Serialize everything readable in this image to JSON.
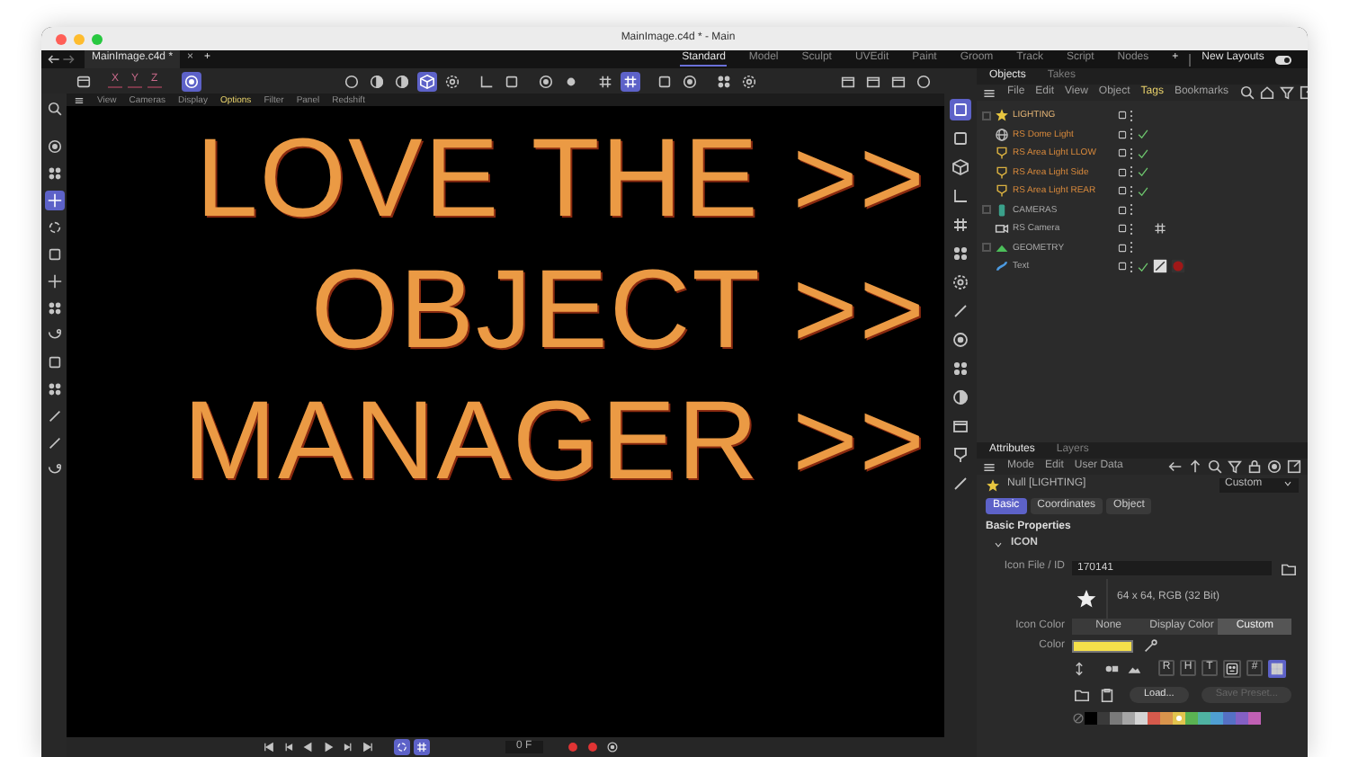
{
  "window": {
    "title": "MainImage.c4d * - Main"
  },
  "document_tab": {
    "label": "MainImage.c4d *",
    "close": "×",
    "add": "+"
  },
  "layouts": [
    {
      "label": "Standard",
      "selected": true
    },
    {
      "label": "Model",
      "selected": false
    },
    {
      "label": "Sculpt",
      "selected": false
    },
    {
      "label": "UVEdit",
      "selected": false
    },
    {
      "label": "Paint",
      "selected": false
    },
    {
      "label": "Groom",
      "selected": false
    },
    {
      "label": "Track",
      "selected": false
    },
    {
      "label": "Script",
      "selected": false
    },
    {
      "label": "Nodes",
      "selected": false
    }
  ],
  "layout_add": "+",
  "new_layouts": {
    "label": "New Layouts",
    "on": true
  },
  "axis_buttons": [
    {
      "label": "X",
      "selected": false
    },
    {
      "label": "Y",
      "selected": false
    },
    {
      "label": "Z",
      "selected": false
    }
  ],
  "toolbar_groups": [
    [
      {
        "kind": "archive",
        "selected": false
      }
    ],
    [
      {
        "kind": "target",
        "selected": true
      }
    ],
    [
      {
        "kind": "circle",
        "selected": false
      },
      {
        "kind": "halfcircle",
        "selected": false
      },
      {
        "kind": "halfcircle",
        "selected": false
      },
      {
        "kind": "cube",
        "selected": true
      },
      {
        "kind": "gear",
        "selected": false
      }
    ],
    [
      {
        "kind": "corner",
        "selected": false
      },
      {
        "kind": "square",
        "selected": false
      }
    ],
    [
      {
        "kind": "target",
        "selected": false
      },
      {
        "kind": "dot",
        "selected": false
      }
    ],
    [
      {
        "kind": "grid",
        "selected": false
      },
      {
        "kind": "grid",
        "selected": true
      }
    ],
    [
      {
        "kind": "square",
        "selected": false
      },
      {
        "kind": "target",
        "selected": false
      }
    ],
    [
      {
        "kind": "dots",
        "selected": false
      },
      {
        "kind": "gear",
        "selected": false
      }
    ],
    [
      {
        "kind": "clapper",
        "selected": false
      },
      {
        "kind": "clapper",
        "selected": false
      },
      {
        "kind": "clapper",
        "selected": false
      },
      {
        "kind": "circle",
        "selected": false
      }
    ]
  ],
  "left_tools": [
    {
      "kind": "search",
      "selected": false
    },
    {
      "kind": "target",
      "selected": false
    },
    {
      "kind": "dots",
      "selected": false
    },
    {
      "kind": "move",
      "selected": true
    },
    {
      "kind": "rotate",
      "selected": false
    },
    {
      "kind": "square",
      "selected": false
    },
    {
      "kind": "move",
      "selected": false
    },
    {
      "kind": "dots",
      "selected": false
    },
    {
      "kind": "arc",
      "selected": false
    },
    {
      "kind": "square",
      "selected": false
    },
    {
      "kind": "dots",
      "selected": false
    },
    {
      "kind": "line",
      "selected": false
    },
    {
      "kind": "line",
      "selected": false
    },
    {
      "kind": "arc",
      "selected": false
    }
  ],
  "viewport": {
    "menu": [
      {
        "label": "View",
        "selected": false
      },
      {
        "label": "Cameras",
        "selected": false
      },
      {
        "label": "Display",
        "selected": false
      },
      {
        "label": "Options",
        "selected": true
      },
      {
        "label": "Filter",
        "selected": false
      },
      {
        "label": "Panel",
        "selected": false
      },
      {
        "label": "Redshift",
        "selected": false
      }
    ],
    "text_lines": [
      "LOVE THE >>",
      "OBJECT >>",
      "MANAGER >>"
    ]
  },
  "timeline": {
    "controls": [
      {
        "kind": "skipback",
        "selected": false
      },
      {
        "kind": "stepback",
        "selected": false
      },
      {
        "kind": "playback",
        "selected": false
      },
      {
        "kind": "play",
        "selected": false
      },
      {
        "kind": "stepfwd",
        "selected": false
      },
      {
        "kind": "skipfwd",
        "selected": false
      },
      {
        "kind": "rotate",
        "selected": true
      },
      {
        "kind": "grid",
        "selected": true
      }
    ],
    "frame": "0 F",
    "record_controls": [
      {
        "kind": "record",
        "selected": false
      },
      {
        "kind": "record",
        "selected": false
      },
      {
        "kind": "target",
        "selected": false
      }
    ]
  },
  "right_strip": [
    {
      "kind": "square",
      "selected": true
    },
    {
      "kind": "square",
      "selected": false
    },
    {
      "kind": "cube",
      "selected": false
    },
    {
      "kind": "corner",
      "selected": false
    },
    {
      "kind": "grid",
      "selected": false
    },
    {
      "kind": "dots",
      "selected": false
    },
    {
      "kind": "gear",
      "selected": false
    },
    {
      "kind": "line",
      "selected": false
    },
    {
      "kind": "target",
      "selected": false
    },
    {
      "kind": "dots",
      "selected": false
    },
    {
      "kind": "halfcircle",
      "selected": false
    },
    {
      "kind": "clapper",
      "selected": false
    },
    {
      "kind": "lamp",
      "selected": false
    },
    {
      "kind": "line",
      "selected": false
    }
  ],
  "object_manager": {
    "tabs": [
      {
        "label": "Objects",
        "selected": true
      },
      {
        "label": "Takes",
        "selected": false
      }
    ],
    "menu": [
      {
        "label": "File",
        "selected": false
      },
      {
        "label": "Edit",
        "selected": false
      },
      {
        "label": "View",
        "selected": false
      },
      {
        "label": "Object",
        "selected": false
      },
      {
        "label": "Tags",
        "selected": true
      },
      {
        "label": "Bookmarks",
        "selected": false
      }
    ],
    "objects": [
      {
        "name": "LIGHTING",
        "kind": "null",
        "highlighted": true,
        "checked": false,
        "expanded": true,
        "children": [
          {
            "name": "RS Dome Light",
            "kind": "dome",
            "highlighted": true,
            "checked": true
          },
          {
            "name": "RS Area Light LLOW",
            "kind": "lamp",
            "highlighted": true,
            "checked": true
          },
          {
            "name": "RS Area Light Side",
            "kind": "lamp",
            "highlighted": true,
            "checked": true
          },
          {
            "name": "RS Area Light REAR",
            "kind": "lamp",
            "highlighted": true,
            "checked": true
          }
        ]
      },
      {
        "name": "CAMERAS",
        "kind": "cylinder",
        "highlighted": false,
        "checked": false,
        "expanded": true,
        "children": [
          {
            "name": "RS Camera",
            "kind": "camera",
            "highlighted": false,
            "checked": false,
            "tags": [
              {
                "kind": "grid"
              }
            ]
          }
        ]
      },
      {
        "name": "GEOMETRY",
        "kind": "triangle",
        "highlighted": false,
        "checked": false,
        "expanded": true,
        "children": [
          {
            "name": "Text",
            "kind": "squiggle",
            "highlighted": false,
            "checked": true,
            "tags": [
              {
                "kind": "phong"
              },
              {
                "kind": "material"
              }
            ]
          }
        ]
      }
    ]
  },
  "attributes": {
    "tabs": [
      {
        "label": "Attributes",
        "selected": true
      },
      {
        "label": "Layers",
        "selected": false
      }
    ],
    "menu": [
      "Mode",
      "Edit",
      "User Data"
    ],
    "object": "Null [LIGHTING]",
    "mode": "Custom",
    "subtabs": [
      {
        "label": "Basic",
        "selected": true
      },
      {
        "label": "Coordinates",
        "selected": false
      },
      {
        "label": "Object",
        "selected": false
      }
    ],
    "section": "Basic Properties",
    "group": {
      "label": "ICON",
      "expanded": true
    },
    "icon_file": {
      "label": "Icon File / ID",
      "value": "170141"
    },
    "preview": "64 x 64, RGB (32 Bit)",
    "icon_color": {
      "label": "Icon Color",
      "options": [
        {
          "label": "None",
          "selected": false
        },
        {
          "label": "Display Color",
          "selected": false
        },
        {
          "label": "Custom",
          "selected": true
        }
      ]
    },
    "color_field": {
      "label": "Color",
      "color": "#f5e04a"
    },
    "style_buttons": [
      {
        "kind": "text",
        "label": "R",
        "selected": false
      },
      {
        "kind": "text",
        "label": "H",
        "selected": false
      },
      {
        "kind": "text",
        "label": "T",
        "selected": false
      },
      {
        "kind": "icon",
        "selected": false
      },
      {
        "kind": "text",
        "label": "#",
        "selected": false
      },
      {
        "kind": "icon",
        "selected": true
      }
    ],
    "load": {
      "label": "Load...",
      "disabled": false
    },
    "save": {
      "label": "Save Preset...",
      "disabled": true
    },
    "palette": [
      {
        "color": "#000000",
        "selected": false
      },
      {
        "color": "#3a3a3a",
        "selected": false
      },
      {
        "color": "#7a7a7a",
        "selected": false
      },
      {
        "color": "#a6a6a6",
        "selected": false
      },
      {
        "color": "#d4d4d4",
        "selected": false
      },
      {
        "color": "#d65a4c",
        "selected": false
      },
      {
        "color": "#d9944c",
        "selected": false
      },
      {
        "color": "#e2c44e",
        "selected": true
      },
      {
        "color": "#5ab352",
        "selected": false
      },
      {
        "color": "#4fb3a2",
        "selected": false
      },
      {
        "color": "#4f9fd2",
        "selected": false
      },
      {
        "color": "#5570c4",
        "selected": false
      },
      {
        "color": "#8460c4",
        "selected": false
      },
      {
        "color": "#c060b4",
        "selected": false
      }
    ]
  }
}
